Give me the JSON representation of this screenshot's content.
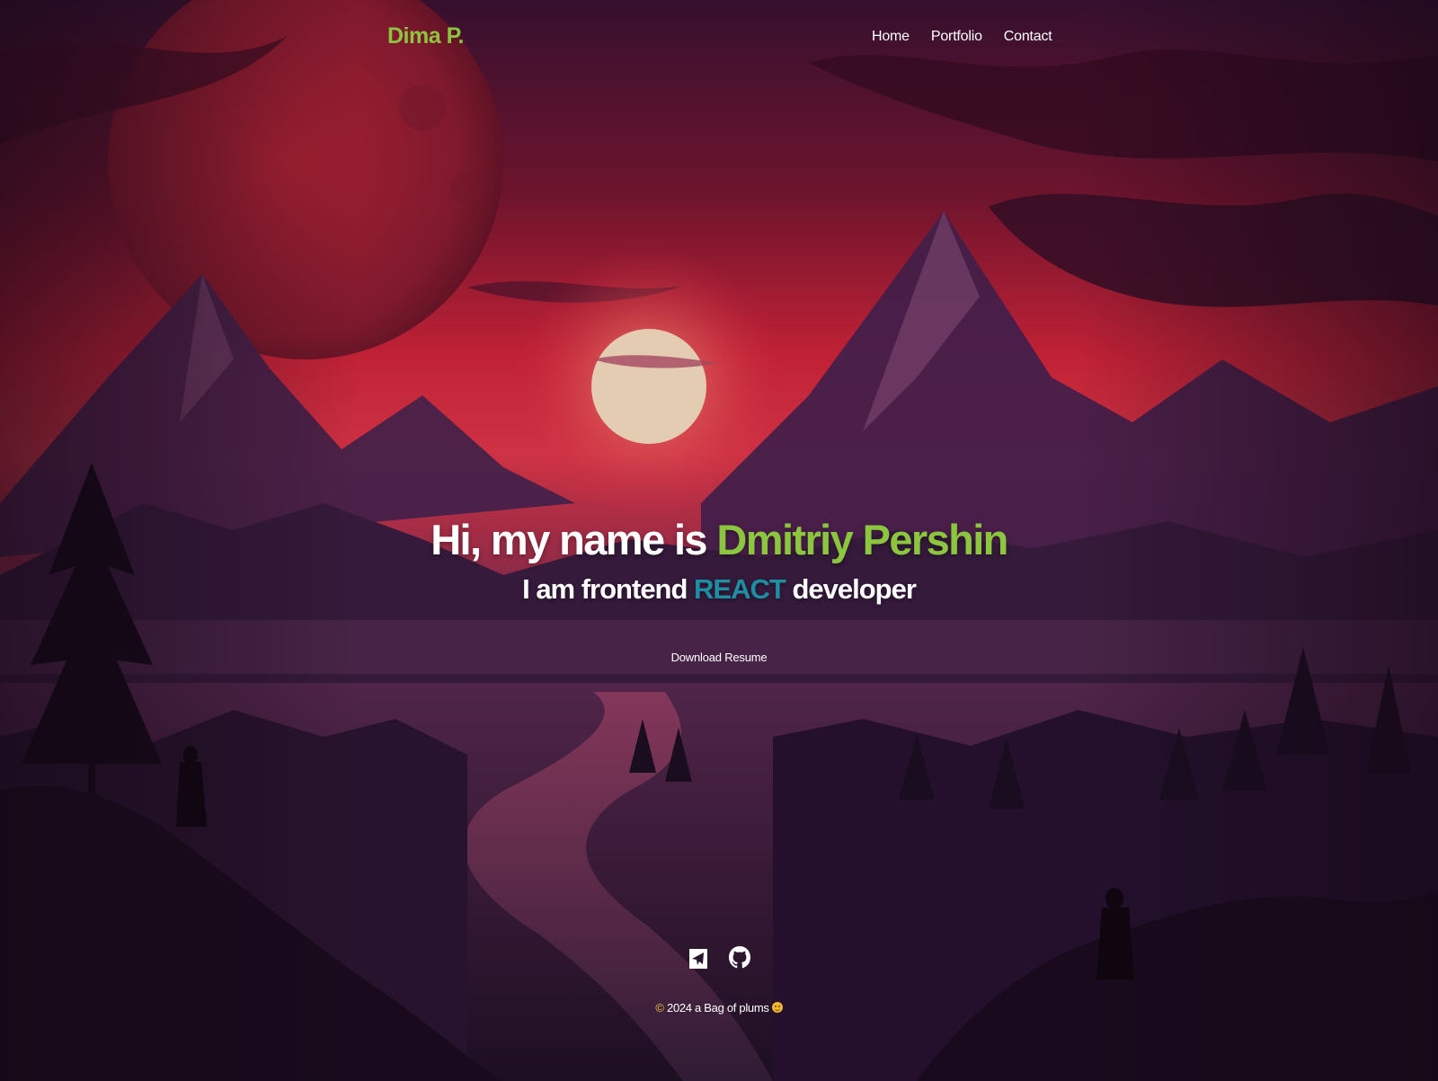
{
  "header": {
    "brand": "Dima P.",
    "nav": [
      {
        "label": "Home",
        "active": true
      },
      {
        "label": "Portfolio",
        "active": false
      },
      {
        "label": "Contact",
        "active": false
      }
    ]
  },
  "hero": {
    "title_prefix": "Hi, my name is ",
    "title_name": "Dmitriy Pershin",
    "subtitle_prefix": "I am frontend ",
    "subtitle_highlight": "REACT",
    "subtitle_suffix": " developer",
    "download_label": "Download Resume"
  },
  "footer": {
    "copyright_symbol": "©",
    "text": " 2024 a Bag of plums",
    "social_icons": [
      "telegram-icon",
      "github-icon"
    ]
  },
  "colors": {
    "accent_green": "#8cc63f",
    "accent_react": "#1d8fa3",
    "nav_indicator": "#2f3fd6",
    "emoji_yellow": "#f0b930"
  }
}
